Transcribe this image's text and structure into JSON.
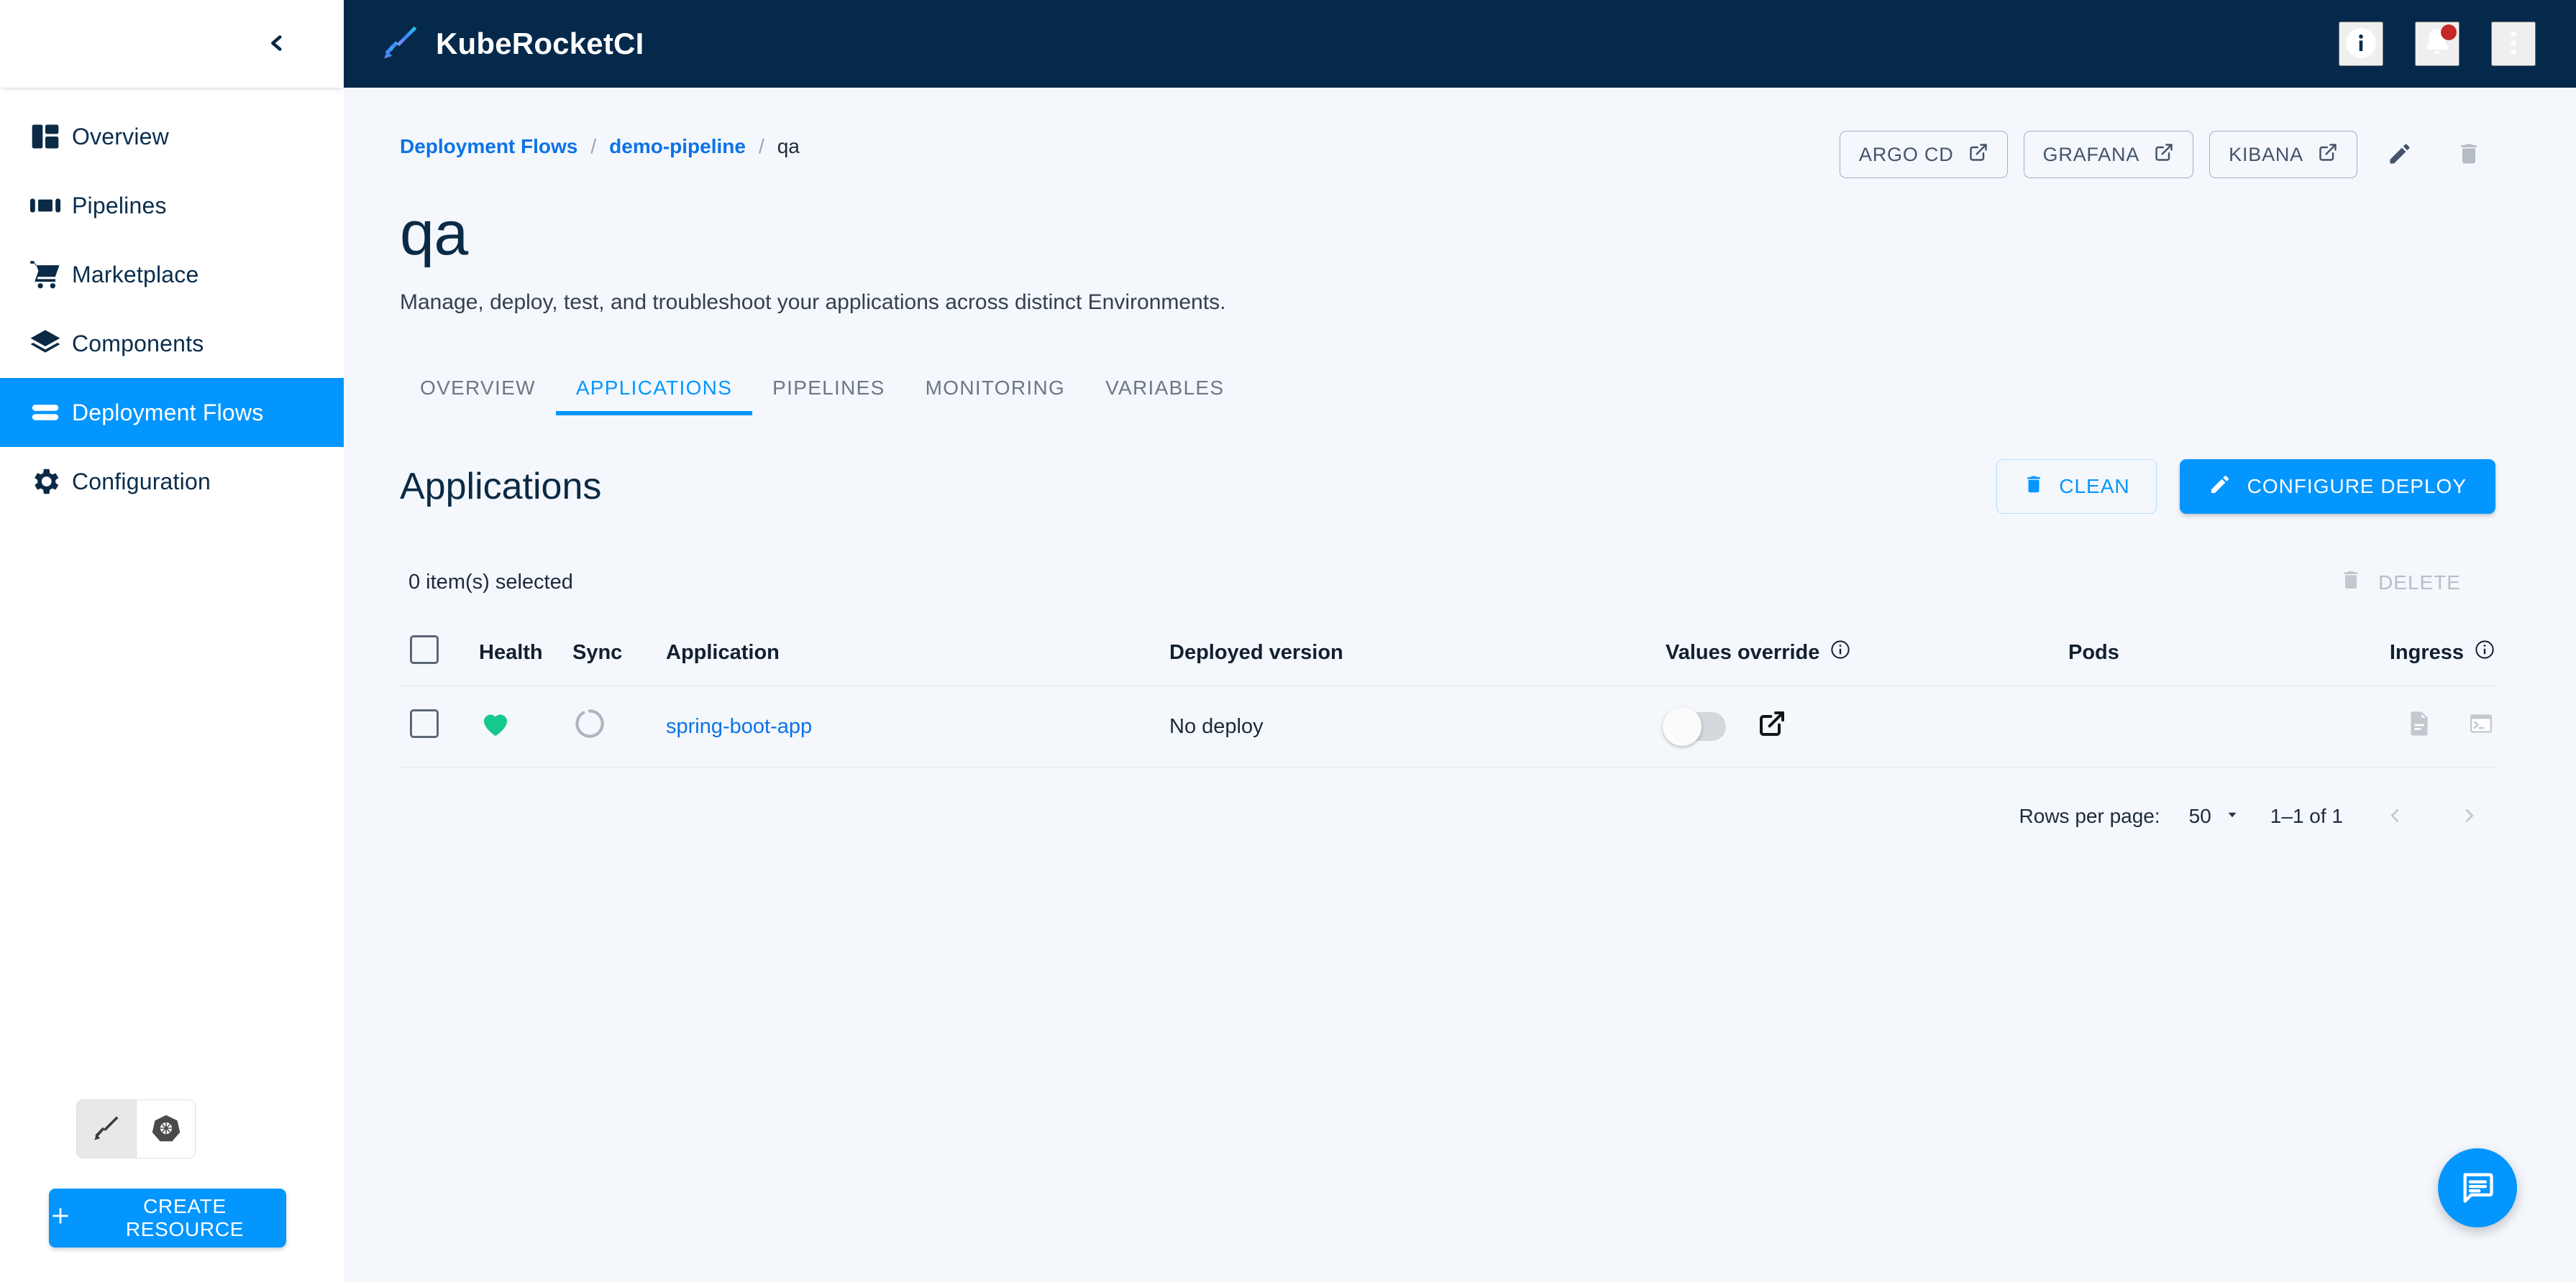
{
  "brand": {
    "title": "KubeRocketCI",
    "logo_icon": "feather-rocket-icon"
  },
  "topbar": {
    "info_icon": "info-circle-icon",
    "notifications_icon": "bell-icon",
    "has_notification_dot": true,
    "menu_icon": "more-vertical-icon"
  },
  "sidebar": {
    "collapse_icon": "chevron-left-icon",
    "items": [
      {
        "label": "Overview",
        "icon": "dashboard-icon",
        "active": false
      },
      {
        "label": "Pipelines",
        "icon": "pipelines-icon",
        "active": false
      },
      {
        "label": "Marketplace",
        "icon": "cart-icon",
        "active": false
      },
      {
        "label": "Components",
        "icon": "layers-icon",
        "active": false
      },
      {
        "label": "Deployment Flows",
        "icon": "deployment-flows-icon",
        "active": true
      },
      {
        "label": "Configuration",
        "icon": "gear-icon",
        "active": false
      }
    ],
    "mode_toggle": [
      {
        "icon": "krci-feather-icon",
        "selected": true
      },
      {
        "icon": "kubernetes-helm-icon",
        "selected": false
      }
    ],
    "create_resource_label": "CREATE RESOURCE",
    "create_resource_icon": "plus-icon"
  },
  "breadcrumb": {
    "items": [
      {
        "label": "Deployment Flows",
        "link": true
      },
      {
        "label": "demo-pipeline",
        "link": true
      },
      {
        "label": "qa",
        "link": false
      }
    ],
    "separator": "/"
  },
  "page": {
    "title": "qa",
    "subtitle": "Manage, deploy, test, and troubleshoot your applications across distinct Environments."
  },
  "page_actions": {
    "external_links": [
      {
        "label": "ARGO CD",
        "icon": "external-link-icon"
      },
      {
        "label": "GRAFANA",
        "icon": "external-link-icon"
      },
      {
        "label": "KIBANA",
        "icon": "external-link-icon"
      }
    ],
    "edit_icon": "pencil-icon",
    "delete_icon": "trash-icon"
  },
  "tabs": [
    {
      "label": "OVERVIEW",
      "active": false
    },
    {
      "label": "APPLICATIONS",
      "active": true
    },
    {
      "label": "PIPELINES",
      "active": false
    },
    {
      "label": "MONITORING",
      "active": false
    },
    {
      "label": "VARIABLES",
      "active": false
    }
  ],
  "applications_section": {
    "title": "Applications",
    "clean_label": "CLEAN",
    "clean_icon": "trash-icon",
    "configure_deploy_label": "CONFIGURE DEPLOY",
    "configure_deploy_icon": "pencil-icon",
    "selected_text": "0 item(s) selected",
    "delete_label": "DELETE",
    "delete_icon": "trash-icon"
  },
  "table": {
    "columns": [
      {
        "key": "check",
        "label": ""
      },
      {
        "key": "health",
        "label": "Health"
      },
      {
        "key": "sync",
        "label": "Sync"
      },
      {
        "key": "application",
        "label": "Application"
      },
      {
        "key": "deployed_version",
        "label": "Deployed version"
      },
      {
        "key": "values_override",
        "label": "Values override",
        "info_icon": "info-outline-icon"
      },
      {
        "key": "pods",
        "label": "Pods"
      },
      {
        "key": "ingress",
        "label": "Ingress",
        "info_icon": "info-outline-icon"
      }
    ],
    "rows": [
      {
        "checked": false,
        "health_status": "healthy",
        "health_icon": "heart-icon",
        "health_color": "#17C88C",
        "sync_status": "progressing",
        "sync_icon": "spinner-icon",
        "application": "spring-boot-app",
        "deployed_version": "No deploy",
        "values_override_enabled": false,
        "values_override_link_icon": "external-link-icon",
        "pods_icons": [
          "document-icon",
          "terminal-icon"
        ],
        "ingress": ""
      }
    ]
  },
  "pagination": {
    "rows_per_page_label": "Rows per page:",
    "rows_per_page_value": "50",
    "dropdown_icon": "caret-down-icon",
    "range_label": "1–1 of 1",
    "prev_icon": "chevron-left-icon",
    "next_icon": "chevron-right-icon"
  },
  "fab": {
    "icon": "chat-bubble-icon",
    "color": "#0496ff"
  },
  "colors": {
    "accent": "#0496ff",
    "header_bg": "#05294b",
    "link": "#0c72e8",
    "page_bg": "#f4f7fc",
    "healthy": "#17C88C",
    "notification_dot": "#c62828"
  }
}
